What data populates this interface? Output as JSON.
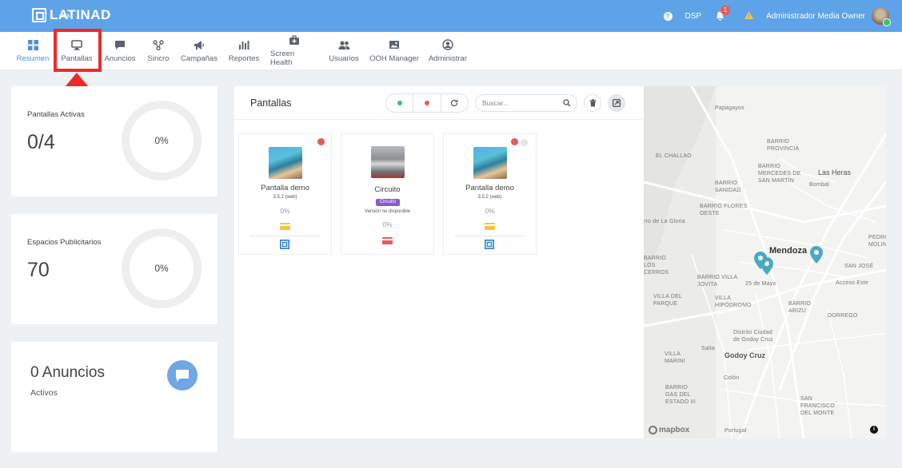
{
  "topbar": {
    "logo": "LATINAD",
    "logo_sub": "CMS",
    "dsp_label": "DSP",
    "notification_count": "1",
    "user_name": "Administrador Media Owner",
    "help_glyph": "?"
  },
  "nav": {
    "items": [
      {
        "label": "Resumen",
        "icon": "dashboard-icon",
        "active": true
      },
      {
        "label": "Pantallas",
        "icon": "monitor-icon"
      },
      {
        "label": "Anuncios",
        "icon": "chat-icon"
      },
      {
        "label": "Sincro",
        "icon": "sync-nodes-icon"
      },
      {
        "label": "Campañas",
        "icon": "megaphone-icon"
      },
      {
        "label": "Reportes",
        "icon": "bar-chart-icon"
      },
      {
        "label": "Screen Health",
        "icon": "medical-kit-icon"
      },
      {
        "label": "Usuarios",
        "icon": "users-icon"
      },
      {
        "label": "OOH Manager",
        "icon": "image-icon"
      },
      {
        "label": "Administrar",
        "icon": "user-circle-icon"
      }
    ]
  },
  "stats": {
    "screens": {
      "label": "Pantallas Activas",
      "value": "0/4",
      "percent": "0%"
    },
    "spaces": {
      "label": "Espacios Publicitarios",
      "value": "70",
      "percent": "0%"
    },
    "ads": {
      "title": "0 Anuncios",
      "subtitle": "Activos"
    }
  },
  "screens_panel": {
    "title": "Pantallas",
    "search_placeholder": "Buscar...",
    "filters": {
      "online_color": "#3fbf6b",
      "offline_color": "#e85a5a"
    },
    "cards": [
      {
        "name": "Pantalla demo",
        "version": "3.5.2 (web)",
        "percent": "0%",
        "status": "offline",
        "payment": "yellow"
      },
      {
        "name": "Circuito",
        "tag": "Circuito",
        "version": "Versión no disponible",
        "percent": "0%",
        "payment": "red"
      },
      {
        "name": "Pantalla demo",
        "version": "3.5.2 (web)",
        "percent": "0%",
        "status": "offline",
        "payment": "yellow"
      }
    ]
  },
  "map": {
    "attribution": "mapbox",
    "info_glyph": "i",
    "labels": {
      "papagayos": "Papagayos",
      "barrio_provincia": "BARRIO\nPROVINCIA",
      "el_challao": "EL CHALLAO",
      "barrio_mercedes": "BARRIO\nMERCEDES DE\nSAN MARTÍN",
      "barrio_sanidad": "BARRIO\nSANIDAD",
      "las_heras": "Las Heras",
      "barrio_flores": "BARRIO FLORES\nOESTE",
      "gloria": "rro de La Gloria",
      "barrio_los_cerros": "BARRIO\nLOS\nCERROS",
      "mendoza": "Mendoza",
      "san_jose": "SAN JOSÉ",
      "pedro_molina": "PEDRO\nMOLINA",
      "barrio_villa_jovita": "BARRIO VILLA\nJOVITA",
      "villa_del_parque": "VILLA DEL\nPARQUE",
      "villa_hipodromo": "VILLA\nHIPÓDROMO",
      "barrio_arizu": "BARRIO\nARIZU",
      "dorrego": "DORREGO",
      "distrito_ciudad": "Distrito Ciudad\nde Godoy Cruz",
      "villa_marini": "VILLA\nMARINI",
      "godoy_cruz": "Godoy Cruz",
      "barrio_gas": "BARRIO\nGAS DEL\nESTADO III",
      "san_francisco": "SAN\nFRANCISCO\nDEL MONTE",
      "acceso_este": "Acceso Este",
      "calle_25_mayo": "25 de Mayo",
      "salta": "Salta",
      "colon": "Colón",
      "bombal": "Bombal",
      "portugal": "Portugal"
    }
  }
}
